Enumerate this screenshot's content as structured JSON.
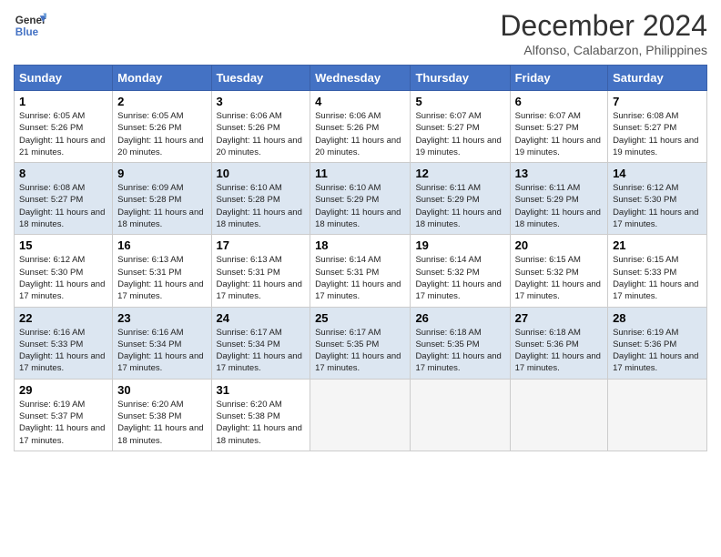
{
  "header": {
    "month_year": "December 2024",
    "location": "Alfonso, Calabarzon, Philippines"
  },
  "days_of_week": [
    "Sunday",
    "Monday",
    "Tuesday",
    "Wednesday",
    "Thursday",
    "Friday",
    "Saturday"
  ],
  "weeks": [
    [
      {
        "day": "1",
        "sunrise": "6:05 AM",
        "sunset": "5:26 PM",
        "daylight": "11 hours and 21 minutes."
      },
      {
        "day": "2",
        "sunrise": "6:05 AM",
        "sunset": "5:26 PM",
        "daylight": "11 hours and 20 minutes."
      },
      {
        "day": "3",
        "sunrise": "6:06 AM",
        "sunset": "5:26 PM",
        "daylight": "11 hours and 20 minutes."
      },
      {
        "day": "4",
        "sunrise": "6:06 AM",
        "sunset": "5:26 PM",
        "daylight": "11 hours and 20 minutes."
      },
      {
        "day": "5",
        "sunrise": "6:07 AM",
        "sunset": "5:27 PM",
        "daylight": "11 hours and 19 minutes."
      },
      {
        "day": "6",
        "sunrise": "6:07 AM",
        "sunset": "5:27 PM",
        "daylight": "11 hours and 19 minutes."
      },
      {
        "day": "7",
        "sunrise": "6:08 AM",
        "sunset": "5:27 PM",
        "daylight": "11 hours and 19 minutes."
      }
    ],
    [
      {
        "day": "8",
        "sunrise": "6:08 AM",
        "sunset": "5:27 PM",
        "daylight": "11 hours and 18 minutes."
      },
      {
        "day": "9",
        "sunrise": "6:09 AM",
        "sunset": "5:28 PM",
        "daylight": "11 hours and 18 minutes."
      },
      {
        "day": "10",
        "sunrise": "6:10 AM",
        "sunset": "5:28 PM",
        "daylight": "11 hours and 18 minutes."
      },
      {
        "day": "11",
        "sunrise": "6:10 AM",
        "sunset": "5:29 PM",
        "daylight": "11 hours and 18 minutes."
      },
      {
        "day": "12",
        "sunrise": "6:11 AM",
        "sunset": "5:29 PM",
        "daylight": "11 hours and 18 minutes."
      },
      {
        "day": "13",
        "sunrise": "6:11 AM",
        "sunset": "5:29 PM",
        "daylight": "11 hours and 18 minutes."
      },
      {
        "day": "14",
        "sunrise": "6:12 AM",
        "sunset": "5:30 PM",
        "daylight": "11 hours and 17 minutes."
      }
    ],
    [
      {
        "day": "15",
        "sunrise": "6:12 AM",
        "sunset": "5:30 PM",
        "daylight": "11 hours and 17 minutes."
      },
      {
        "day": "16",
        "sunrise": "6:13 AM",
        "sunset": "5:31 PM",
        "daylight": "11 hours and 17 minutes."
      },
      {
        "day": "17",
        "sunrise": "6:13 AM",
        "sunset": "5:31 PM",
        "daylight": "11 hours and 17 minutes."
      },
      {
        "day": "18",
        "sunrise": "6:14 AM",
        "sunset": "5:31 PM",
        "daylight": "11 hours and 17 minutes."
      },
      {
        "day": "19",
        "sunrise": "6:14 AM",
        "sunset": "5:32 PM",
        "daylight": "11 hours and 17 minutes."
      },
      {
        "day": "20",
        "sunrise": "6:15 AM",
        "sunset": "5:32 PM",
        "daylight": "11 hours and 17 minutes."
      },
      {
        "day": "21",
        "sunrise": "6:15 AM",
        "sunset": "5:33 PM",
        "daylight": "11 hours and 17 minutes."
      }
    ],
    [
      {
        "day": "22",
        "sunrise": "6:16 AM",
        "sunset": "5:33 PM",
        "daylight": "11 hours and 17 minutes."
      },
      {
        "day": "23",
        "sunrise": "6:16 AM",
        "sunset": "5:34 PM",
        "daylight": "11 hours and 17 minutes."
      },
      {
        "day": "24",
        "sunrise": "6:17 AM",
        "sunset": "5:34 PM",
        "daylight": "11 hours and 17 minutes."
      },
      {
        "day": "25",
        "sunrise": "6:17 AM",
        "sunset": "5:35 PM",
        "daylight": "11 hours and 17 minutes."
      },
      {
        "day": "26",
        "sunrise": "6:18 AM",
        "sunset": "5:35 PM",
        "daylight": "11 hours and 17 minutes."
      },
      {
        "day": "27",
        "sunrise": "6:18 AM",
        "sunset": "5:36 PM",
        "daylight": "11 hours and 17 minutes."
      },
      {
        "day": "28",
        "sunrise": "6:19 AM",
        "sunset": "5:36 PM",
        "daylight": "11 hours and 17 minutes."
      }
    ],
    [
      {
        "day": "29",
        "sunrise": "6:19 AM",
        "sunset": "5:37 PM",
        "daylight": "11 hours and 17 minutes."
      },
      {
        "day": "30",
        "sunrise": "6:20 AM",
        "sunset": "5:38 PM",
        "daylight": "11 hours and 18 minutes."
      },
      {
        "day": "31",
        "sunrise": "6:20 AM",
        "sunset": "5:38 PM",
        "daylight": "11 hours and 18 minutes."
      },
      null,
      null,
      null,
      null
    ]
  ],
  "labels": {
    "sunrise_prefix": "Sunrise: ",
    "sunset_prefix": "Sunset: ",
    "daylight_prefix": "Daylight: "
  }
}
